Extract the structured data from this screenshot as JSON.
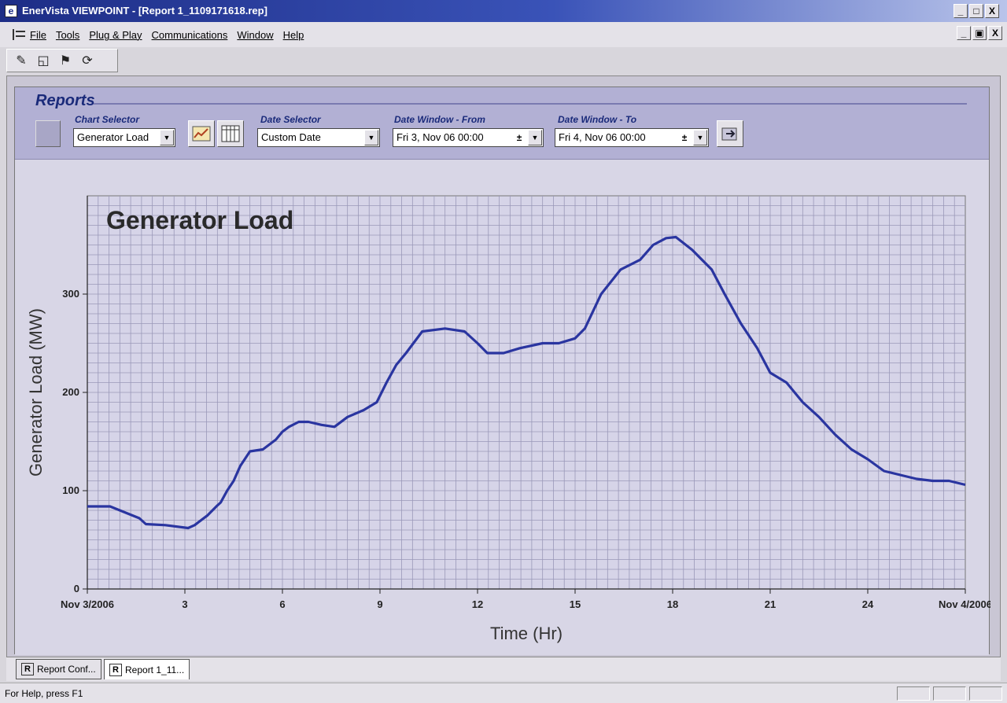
{
  "window": {
    "title": "EnerVista VIEWPOINT - [Report 1_1109171618.rep]",
    "min": "_",
    "max": "□",
    "close": "X"
  },
  "menu": {
    "items": [
      "File",
      "Tools",
      "Plug & Play",
      "Communications",
      "Window",
      "Help"
    ]
  },
  "report": {
    "title": "Reports",
    "chart_selector_label": "Chart Selector",
    "chart_selector_value": "Generator Load",
    "date_selector_label": "Date Selector",
    "date_selector_value": "Custom Date",
    "from_label": "Date Window - From",
    "from_value": "Fri 3, Nov 06 00:00",
    "to_label": "Date Window - To",
    "to_value": "Fri 4, Nov 06 00:00"
  },
  "tabs": [
    "Report Conf...",
    "Report 1_11..."
  ],
  "status": {
    "text": "For Help, press F1"
  },
  "chart_data": {
    "type": "line",
    "title": "Generator Load",
    "xlabel": "Time (Hr)",
    "ylabel": "Generator Load (MW)",
    "xlim": [
      0,
      27
    ],
    "ylim": [
      0,
      400
    ],
    "x_ticks": [
      0,
      3,
      6,
      9,
      12,
      15,
      18,
      21,
      24,
      27
    ],
    "x_tick_labels": [
      "Nov 3/2006",
      "3",
      "6",
      "9",
      "12",
      "15",
      "18",
      "21",
      "24",
      "Nov 4/2006"
    ],
    "y_ticks": [
      0,
      100,
      200,
      300
    ],
    "grid": true,
    "series": [
      {
        "color": "#2a35a0",
        "x": [
          0,
          0.7,
          1,
          1.6,
          1.8,
          2.4,
          3.1,
          3.3,
          3.7,
          4,
          4.1,
          4.3,
          4.5,
          4.7,
          5,
          5.4,
          5.8,
          6,
          6.2,
          6.5,
          6.8,
          7.2,
          7.6,
          8,
          8.5,
          8.9,
          9.2,
          9.5,
          9.8,
          10.3,
          11,
          11.6,
          12,
          12.3,
          12.8,
          13.3,
          14,
          14.5,
          15,
          15.3,
          15.8,
          16.4,
          17,
          17.4,
          17.8,
          18.1,
          18.6,
          19.2,
          19.6,
          20.1,
          20.6,
          21,
          21.5,
          22,
          22.5,
          23,
          23.5,
          24,
          24.5,
          25,
          25.5,
          26,
          26.5,
          27
        ],
        "y": [
          84,
          84,
          80,
          72,
          66,
          65,
          62,
          65,
          75,
          85,
          88,
          100,
          110,
          125,
          140,
          142,
          152,
          160,
          165,
          170,
          170,
          167,
          165,
          175,
          182,
          190,
          210,
          228,
          240,
          262,
          265,
          262,
          250,
          240,
          240,
          245,
          250,
          250,
          255,
          265,
          300,
          325,
          335,
          350,
          357,
          358,
          345,
          325,
          300,
          270,
          245,
          220,
          210,
          190,
          175,
          157,
          142,
          132,
          120,
          116,
          112,
          110,
          110,
          106
        ]
      }
    ]
  }
}
